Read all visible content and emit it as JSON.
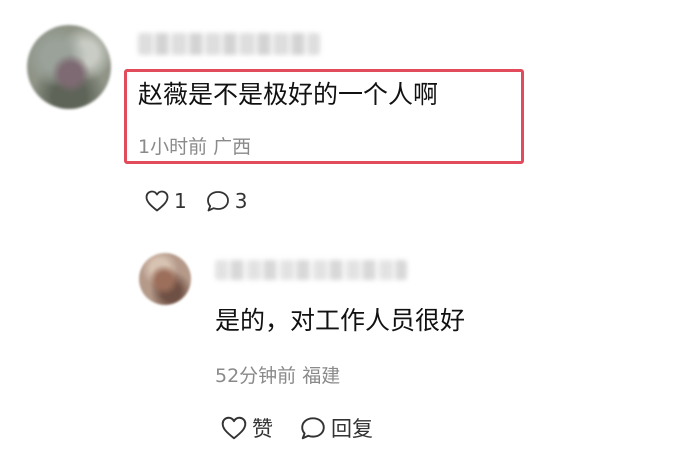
{
  "comment": {
    "text": "赵薇是不是极好的一个人啊",
    "time": "1小时前",
    "location": "广西",
    "like_count": "1",
    "reply_count": "3",
    "like_icon": "heart-outline-icon",
    "reply_icon": "speech-bubble-icon"
  },
  "reply": {
    "text": "是的，对工作人员很好",
    "time": "52分钟前",
    "location": "福建",
    "like_label": "赞",
    "reply_label": "回复",
    "like_icon": "heart-outline-icon",
    "reply_icon": "speech-bubble-icon"
  },
  "colors": {
    "highlight": "#e24b5b",
    "meta_text": "#8a8a8a",
    "body_text": "#111111"
  }
}
